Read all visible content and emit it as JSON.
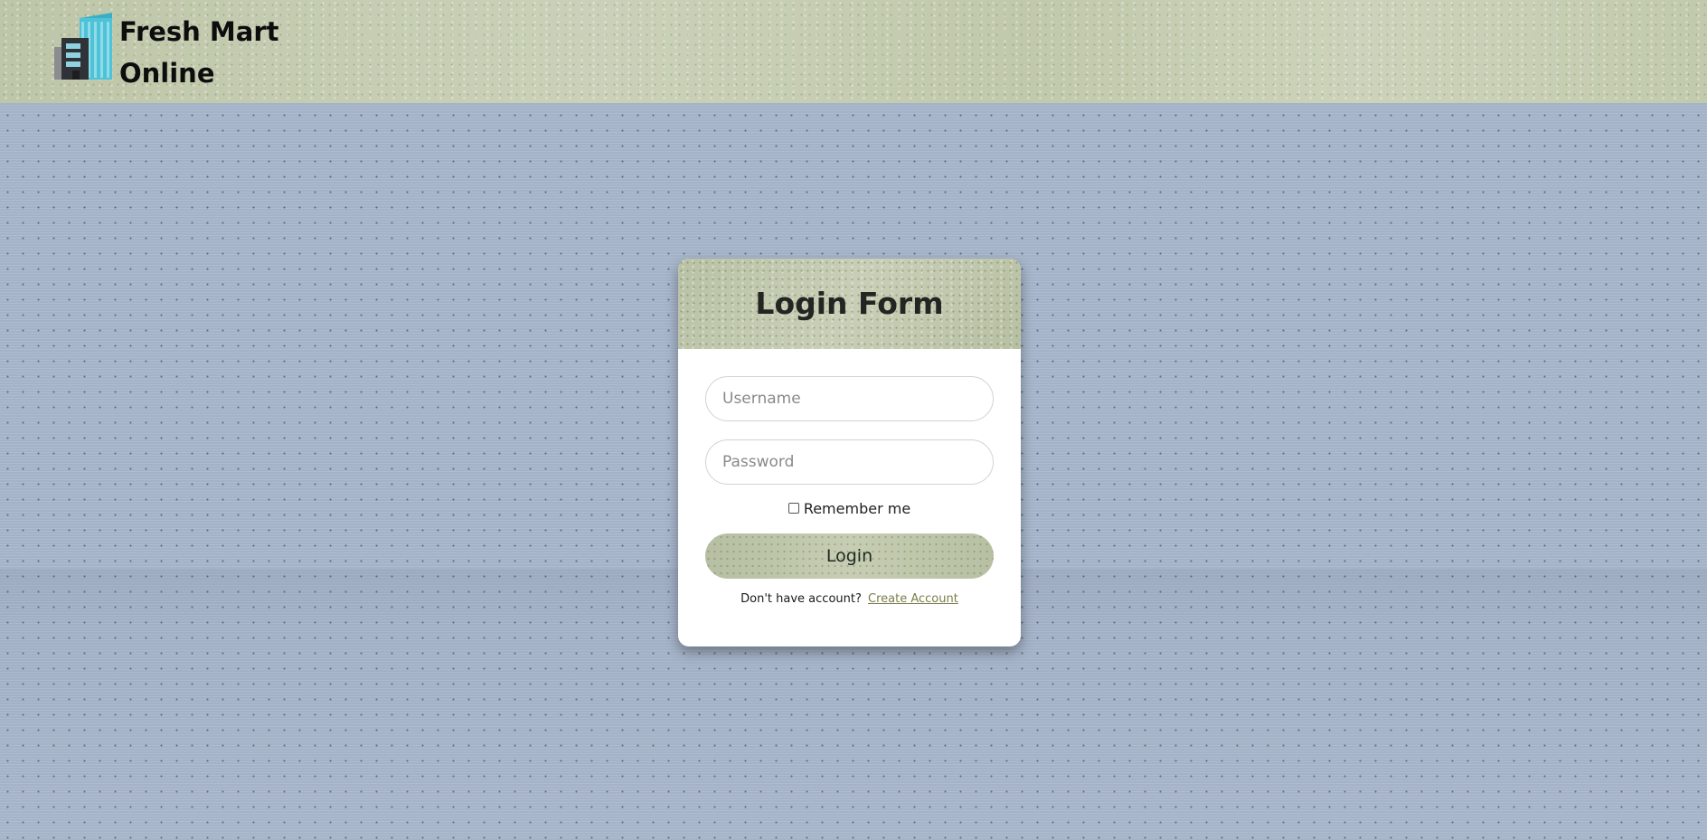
{
  "brand": {
    "line1": "Fresh Mart",
    "line2": "Online",
    "logo_icon": "building-icon"
  },
  "login_form": {
    "title": "Login Form",
    "username_placeholder": "Username",
    "username_value": "",
    "password_placeholder": "Password",
    "password_value": "",
    "remember_label": "Remember me",
    "remember_checked": false,
    "submit_label": "Login",
    "signup_prompt": "Don't have account?",
    "signup_link": "Create Account"
  },
  "colors": {
    "page_background": "#a9b8cd",
    "header_background": "#c4cbb1",
    "accent": "#bfc7ad",
    "link": "#7b7d4a",
    "logo_primary": "#4ec3d8",
    "logo_secondary": "#2f3237"
  }
}
